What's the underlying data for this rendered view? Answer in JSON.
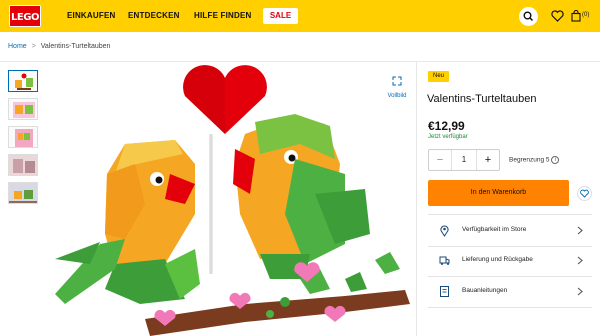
{
  "header": {
    "logo_text": "LEGO",
    "nav": [
      "EINKAUFEN",
      "ENTDECKEN",
      "HILFE FINDEN"
    ],
    "sale_label": "SALE",
    "bag_count": "(0)"
  },
  "icons": [
    "search-icon",
    "heart-icon",
    "bag-icon",
    "fullscreen-icon",
    "location-pin-icon",
    "delivery-icon",
    "instructions-icon",
    "chevron-right-icon",
    "info-icon"
  ],
  "breadcrumb": {
    "home": "Home",
    "separator": ">",
    "current": "Valentins-Turteltauben"
  },
  "gallery": {
    "fullscreen_label": "Vollbild",
    "thumbnail_count": 5,
    "active_thumbnail": 1
  },
  "product": {
    "badge": "Neu",
    "title": "Valentins-Turteltauben",
    "price": "€12,99",
    "availability": "Jetzt verfügbar",
    "quantity": "1",
    "minus": "−",
    "plus": "+",
    "limit_label": "Begrenzung 5",
    "info_symbol": "i",
    "add_to_cart": "In den Warenkorb"
  },
  "info_rows": [
    {
      "label": "Verfügbarkeit im Store",
      "icon": "location-pin-icon"
    },
    {
      "label": "Lieferung und Rückgabe",
      "icon": "delivery-icon"
    },
    {
      "label": "Bauanleitungen",
      "icon": "instructions-icon"
    }
  ],
  "colors": {
    "brand_yellow": "#ffcf00",
    "logo_red": "#e3000b",
    "cta_orange": "#ff8200",
    "link_blue": "#006cb7",
    "available_green": "#1c8a3a"
  }
}
